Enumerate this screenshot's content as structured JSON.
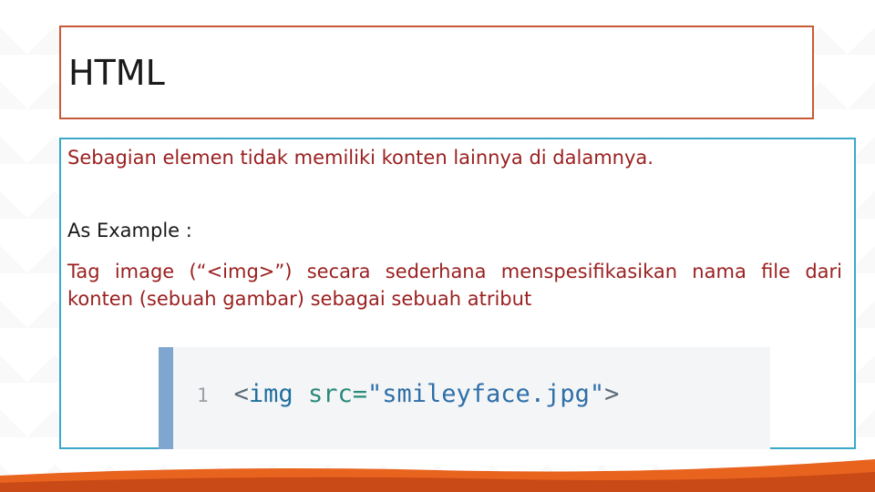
{
  "slide": {
    "title": "HTML",
    "line1": "Sebagian elemen tidak memiliki konten lainnya di dalamnya.",
    "example_heading": "As Example :",
    "paragraph": "Tag image (“<img>”) secara sederhana menspesifikasikan nama file dari konten (sebuah gambar) sebagai sebuah atribut",
    "code": {
      "line_number": "1",
      "open": "<",
      "tag": "img",
      "attr": "src=",
      "value": "\"smileyface.jpg\"",
      "close": ">"
    }
  },
  "colors": {
    "title_border": "#c85a37",
    "content_border": "#3aa8c9",
    "text_red": "#9a1f1f",
    "accent_orange": "#e8631e"
  }
}
